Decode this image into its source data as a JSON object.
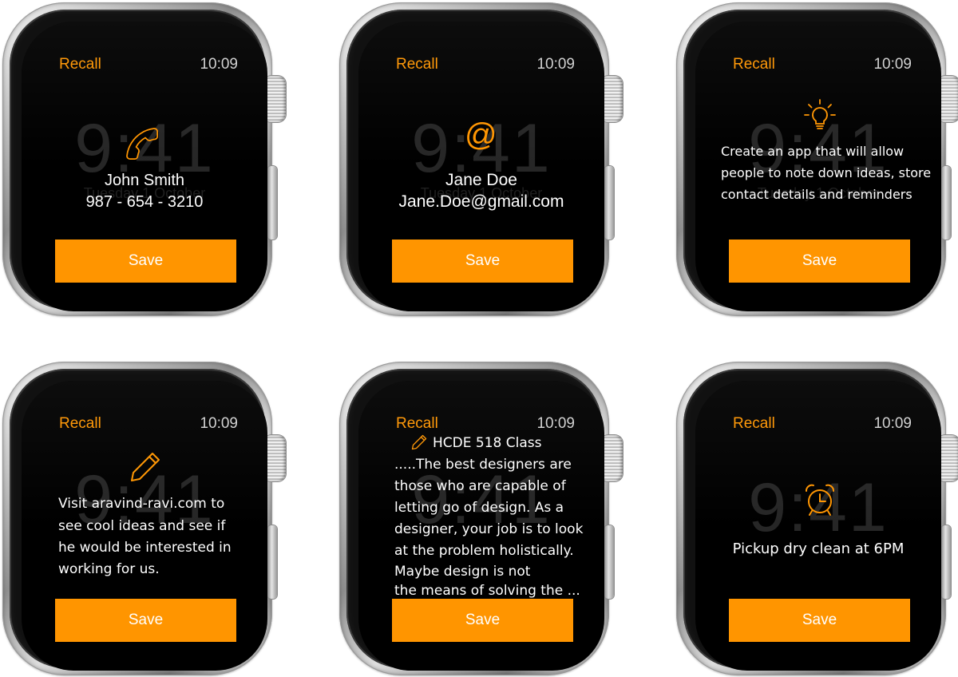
{
  "accent_color": "#ff9500",
  "watches": [
    {
      "app_title": "Recall",
      "time": "10:09",
      "icon": "phone-icon",
      "name": "John Smith",
      "detail": "987 - 654 - 3210",
      "save_label": "Save"
    },
    {
      "app_title": "Recall",
      "time": "10:09",
      "icon": "at-sign-icon",
      "name": "Jane Doe",
      "detail": "Jane.Doe@gmail.com",
      "save_label": "Save"
    },
    {
      "app_title": "Recall",
      "time": "10:09",
      "icon": "lightbulb-icon",
      "lines": [
        "Create an app that will allow",
        "people to note down ideas, store",
        "contact details and reminders"
      ],
      "save_label": "Save"
    },
    {
      "app_title": "Recall",
      "time": "10:09",
      "icon": "pencil-icon",
      "lines": [
        "Visit aravind-ravi.com to",
        "see cool ideas and see if",
        "he would be interested in",
        "working for us."
      ],
      "save_label": "Save"
    },
    {
      "app_title": "Recall",
      "time": "10:09",
      "icon": "pencil-icon",
      "note_title": "HCDE 518 Class",
      "lines": [
        ".....The best designers are",
        "those who are capable of",
        "letting go of design. As a",
        "designer, your job is to look",
        "at the problem holistically.",
        "Maybe design is not",
        "the means of solving the ..."
      ],
      "save_label": "Save"
    },
    {
      "app_title": "Recall",
      "time": "10:09",
      "icon": "alarm-clock-icon",
      "reminder": "Pickup dry clean at 6PM",
      "save_label": "Save"
    }
  ]
}
